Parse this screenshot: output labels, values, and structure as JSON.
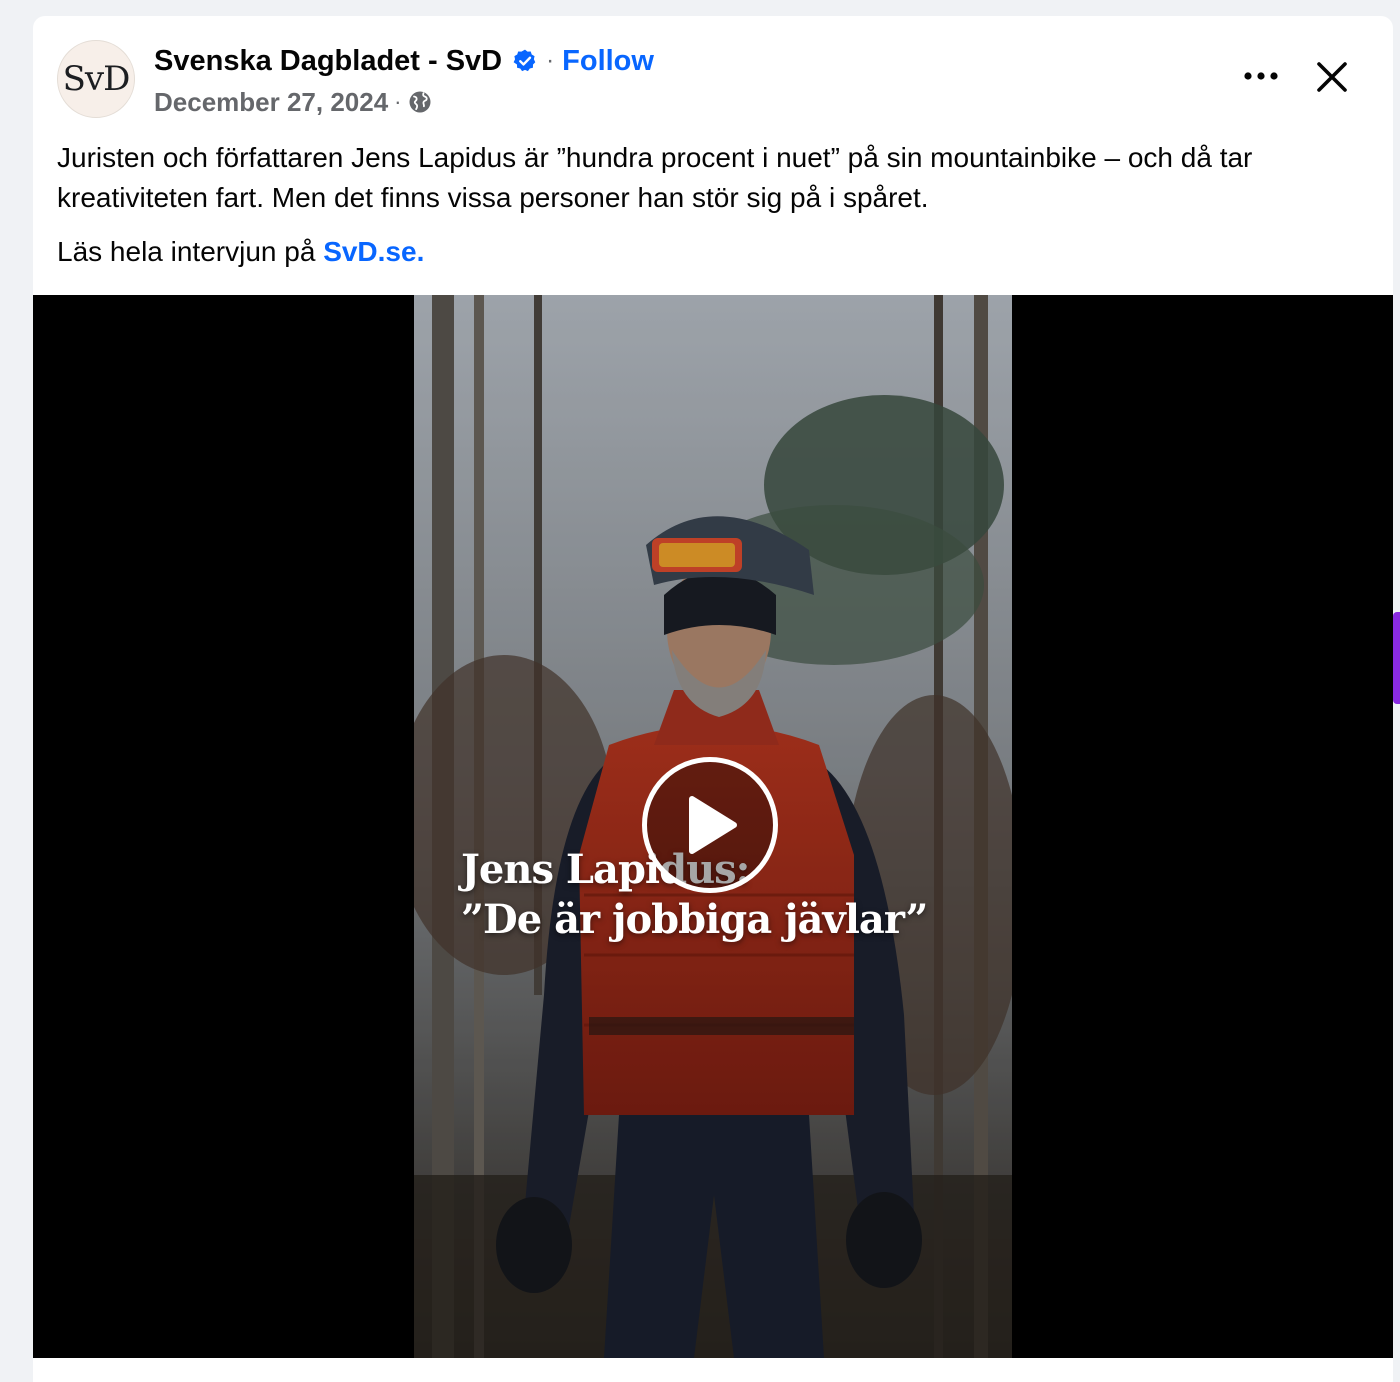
{
  "post": {
    "author": {
      "name": "Svenska Dagbladet - SvD",
      "avatar_text": "SvD",
      "verified": true
    },
    "follow_label": "Follow",
    "separator": "·",
    "date": "December 27, 2024",
    "audience_icon": "globe-icon",
    "menu_icon": "more-horizontal-icon",
    "close_icon": "close-icon",
    "text": "Juristen och författaren Jens Lapidus är ”hundra procent i nuet” på sin mountainbike – och då tar kreativiteten fart. Men det finns vissa personer han stör sig på i spåret.",
    "read_more_prefix": "Läs hela intervjun på ",
    "read_more_link": "SvD.se.",
    "video": {
      "title_line1": "Jens Lapidus:",
      "title_line2": "”De är jobbiga jävlar”",
      "play_icon": "play-icon"
    }
  },
  "colors": {
    "link_blue": "#0866ff",
    "verified_blue": "#0866ff",
    "text_primary": "#050505",
    "text_secondary": "#65676b",
    "video_background": "#000000",
    "page_background": "#f0f2f5"
  }
}
